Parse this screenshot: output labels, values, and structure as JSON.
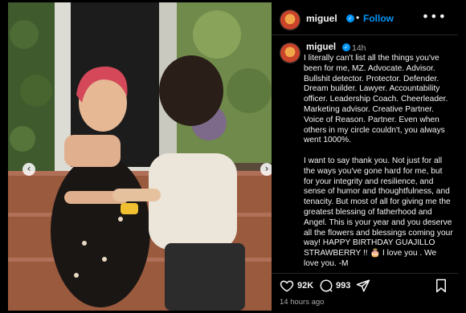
{
  "header": {
    "username": "miguel",
    "separator": "•",
    "follow_label": "Follow",
    "more_glyph": "•••"
  },
  "caption": {
    "username": "miguel",
    "time": "14h",
    "text": "I literally can't list all the things you've been for me, MZ. Advocate. Advisor. Bullshit detector. Protector. Defender. Dream builder. Lawyer. Accountability officer. Leadership Coach. Cheerleader. Marketing advisor. Creative Partner. Voice of Reason. Partner. Even when others in my circle couldn't, you always went 1000%.\n\nI want to say thank you. Not just for all the ways you've gone hard for me, but for your integrity and resilience, and sense of humor and thoughtfulness, and tenacity. But most of all for giving me the greatest blessing of fatherhood and Angel. This is your year and you deserve all the flowers and blessings coming your way!  HAPPY BIRTHDAY GUAJILLO STRAWBERRY !! 🎂 I love you . We love you. -M"
  },
  "actions": {
    "likes": "92K",
    "comments": "993",
    "timestamp": "14 hours ago"
  },
  "icons": {
    "prev": "chevron-left-icon",
    "next": "chevron-right-icon",
    "like": "heart-icon",
    "comment": "comment-bubble-icon",
    "share": "paper-plane-icon",
    "save": "bookmark-icon",
    "verified": "verified-badge-icon"
  },
  "colors": {
    "background": "#000000",
    "accent": "#0095f6",
    "muted": "#a8a8a8",
    "divider": "#262626"
  }
}
